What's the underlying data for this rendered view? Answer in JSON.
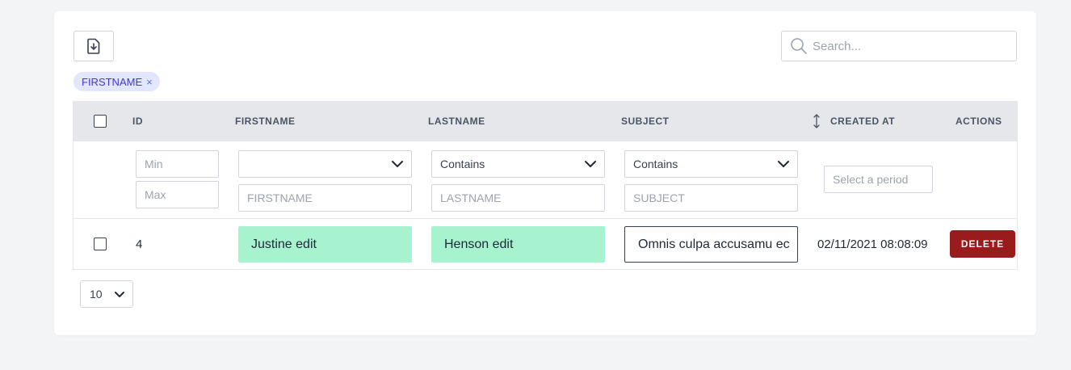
{
  "toolbar": {
    "search_placeholder": "Search..."
  },
  "active_filters": [
    {
      "label": "FIRSTNAME",
      "remove_glyph": "×"
    }
  ],
  "table": {
    "columns": {
      "id": "ID",
      "firstname": "FIRSTNAME",
      "lastname": "LASTNAME",
      "subject": "SUBJECT",
      "created_at": "CREATED AT",
      "actions": "ACTIONS"
    },
    "filters": {
      "id_min_placeholder": "Min",
      "id_max_placeholder": "Max",
      "firstname_operator": "",
      "firstname_placeholder": "FIRSTNAME",
      "lastname_operator": "Contains",
      "lastname_placeholder": "LASTNAME",
      "subject_operator": "Contains",
      "subject_placeholder": "SUBJECT",
      "created_at_placeholder": "Select a period"
    },
    "rows": [
      {
        "id": "4",
        "firstname": "Justine edit",
        "lastname": "Henson edit",
        "subject": "Omnis culpa accusamu ec",
        "created_at": "02/11/2021 08:08:09",
        "action_label": "DELETE"
      }
    ]
  },
  "pagination": {
    "per_page": "10"
  },
  "colors": {
    "edited_cell": "#a7f3d0",
    "delete_button": "#991b1b",
    "chip_bg": "#e0e7ff",
    "chip_text": "#4338ca"
  },
  "icons": {
    "export": "file-download-icon",
    "search": "search-icon",
    "sort": "sort-vertical-icon",
    "dropdown": "chevron-down-icon"
  }
}
